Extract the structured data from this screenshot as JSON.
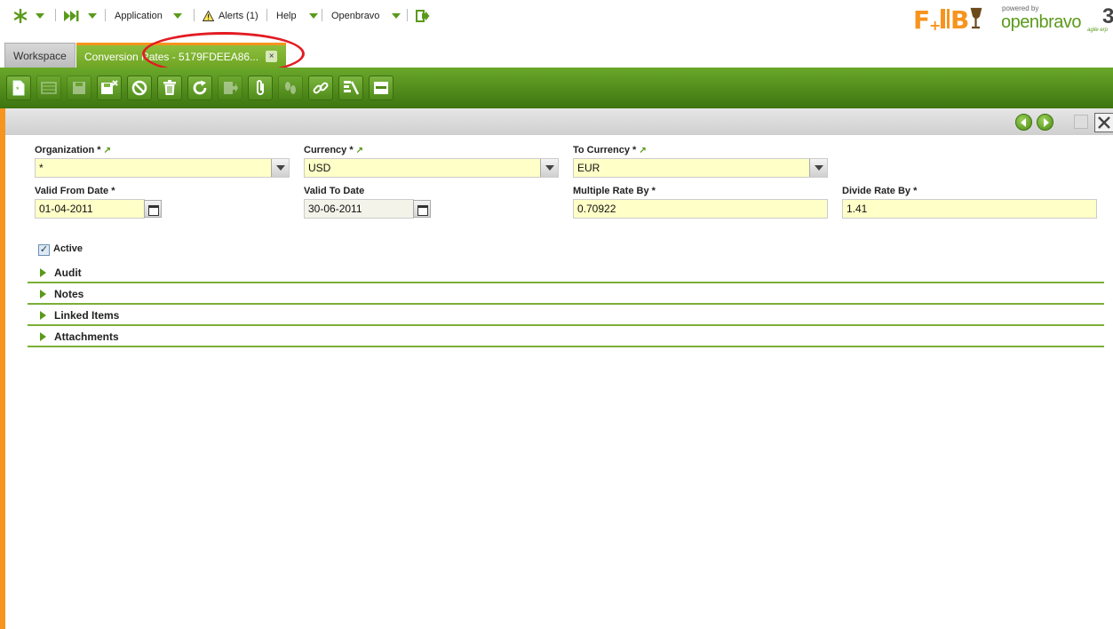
{
  "topnav": {
    "application": "Application",
    "alerts": "Alerts (1)",
    "help": "Help",
    "openbravo": "Openbravo"
  },
  "brand": {
    "client_logo": "F+B",
    "powered_by": "powered by",
    "product": "openbravo",
    "version": "3",
    "tagline": "agile erp"
  },
  "tabs": {
    "workspace": "Workspace",
    "active": "Conversion Rates - 5179FDEEA86...",
    "close_glyph": "×"
  },
  "toolbar": {
    "buttons": [
      "new-document",
      "new-grid",
      "save",
      "save-close",
      "undo",
      "delete",
      "refresh",
      "export",
      "attachment",
      "audit",
      "link",
      "tree",
      "toggle-view"
    ]
  },
  "form": {
    "organization": {
      "label": "Organization *",
      "value": "*"
    },
    "currency": {
      "label": "Currency *",
      "value": "USD"
    },
    "to_currency": {
      "label": "To Currency *",
      "value": "EUR"
    },
    "valid_from": {
      "label": "Valid From Date *",
      "value": "01-04-2011"
    },
    "valid_to": {
      "label": "Valid To Date",
      "value": "30-06-2011"
    },
    "multiple_rate": {
      "label": "Multiple Rate By *",
      "value": "0.70922"
    },
    "divide_rate": {
      "label": "Divide Rate By *",
      "value": "1.41"
    },
    "active": {
      "label": "Active",
      "checked": true,
      "glyph": "✓"
    }
  },
  "sections": [
    "Audit",
    "Notes",
    "Linked Items",
    "Attachments"
  ],
  "colors": {
    "accent_green": "#5a9a1b",
    "toolbar_green": "#4f8b1a",
    "accent_orange": "#f7941d",
    "required_field": "#ffffc8",
    "highlight_red": "#e31b23"
  }
}
